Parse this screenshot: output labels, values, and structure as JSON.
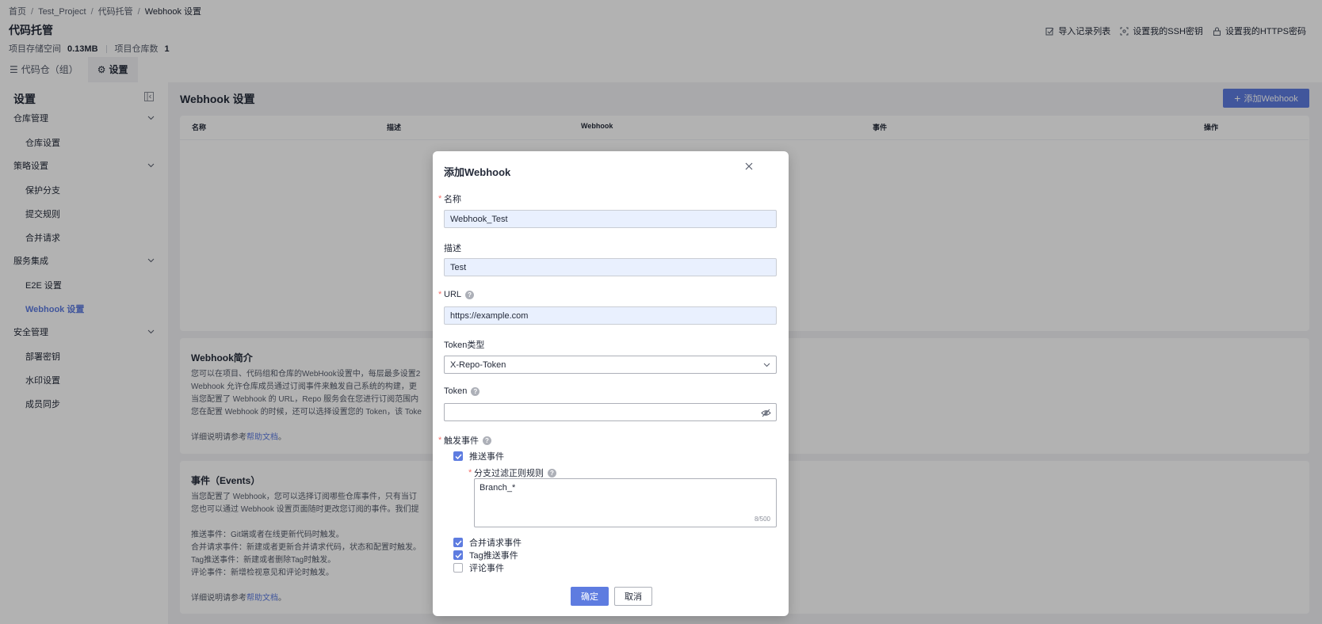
{
  "breadcrumb": [
    "首页",
    "Test_Project",
    "代码托管",
    "Webhook 设置"
  ],
  "header": {
    "title": "代码托管",
    "storage_label": "项目存储空间",
    "storage_value": "0.13MB",
    "repo_count_label": "项目仓库数",
    "repo_count_value": "1",
    "actions": [
      "导入记录列表",
      "设置我的SSH密钥",
      "设置我的HTTPS密码"
    ]
  },
  "tabs": [
    {
      "label": "代码仓（组）",
      "icon": "list-icon"
    },
    {
      "label": "设置",
      "icon": "gear-icon"
    }
  ],
  "sidebar": {
    "title": "设置",
    "groups": [
      {
        "label": "仓库管理",
        "items": [
          "仓库设置"
        ]
      },
      {
        "label": "策略设置",
        "items": [
          "保护分支",
          "提交规则",
          "合并请求"
        ]
      },
      {
        "label": "服务集成",
        "items": [
          "E2E 设置",
          "Webhook 设置"
        ]
      },
      {
        "label": "安全管理",
        "items": [
          "部署密钥",
          "水印设置",
          "成员同步"
        ]
      }
    ],
    "active_item": "Webhook 设置"
  },
  "main": {
    "title": "Webhook 设置",
    "add_button": "添加Webhook",
    "table_columns": [
      "名称",
      "描述",
      "Webhook",
      "事件",
      "操作"
    ],
    "intro": {
      "title": "Webhook简介",
      "lines": [
        "您可以在项目、代码组和仓库的WebHook设置中，每层最多设置2",
        "Webhook 允许仓库成员通过订阅事件来触发自己系统的构建，更",
        "当您配置了 Webhook 的 URL，Repo 服务会在您进行订阅范围内",
        "您在配置 Webhook 的时候，还可以选择设置您的 Token，该 Toke"
      ],
      "help_prefix": "详细说明请参考",
      "help_link": "帮助文档",
      "help_suffix": "。"
    },
    "events": {
      "title": "事件（Events）",
      "lines": [
        "当您配置了 Webhook，您可以选择订阅哪些仓库事件，只有当订",
        "您也可以通过 Webhook 设置页面随时更改您订阅的事件。我们提"
      ],
      "event_lines": [
        "推送事件：Git端或者在线更新代码时触发。",
        "合并请求事件：新建或者更新合并请求代码，状态和配置时触发。",
        "Tag推送事件：新建或者删除Tag时触发。",
        "评论事件：新增检视意见和评论时触发。"
      ],
      "help_prefix": "详细说明请参考",
      "help_link": "帮助文档",
      "help_suffix": "。"
    }
  },
  "modal": {
    "title": "添加Webhook",
    "name_label": "名称",
    "name_value": "Webhook_Test",
    "desc_label": "描述",
    "desc_value": "Test",
    "url_label": "URL",
    "url_value": "https://example.com",
    "token_type_label": "Token类型",
    "token_type_value": "X-Repo-Token",
    "token_label": "Token",
    "token_value": "",
    "events_label": "触发事件",
    "events": [
      {
        "label": "推送事件",
        "checked": true
      },
      {
        "label": "合并请求事件",
        "checked": true
      },
      {
        "label": "Tag推送事件",
        "checked": true
      },
      {
        "label": "评论事件",
        "checked": false
      }
    ],
    "branch_filter_label": "分支过滤正则规则",
    "branch_filter_value": "Branch_*",
    "branch_filter_count": "8/500",
    "confirm_label": "确定",
    "cancel_label": "取消"
  },
  "colors": {
    "accent": "#5e7ce0",
    "required": "#f66f6a",
    "input_filled": "#e9f0fe"
  }
}
